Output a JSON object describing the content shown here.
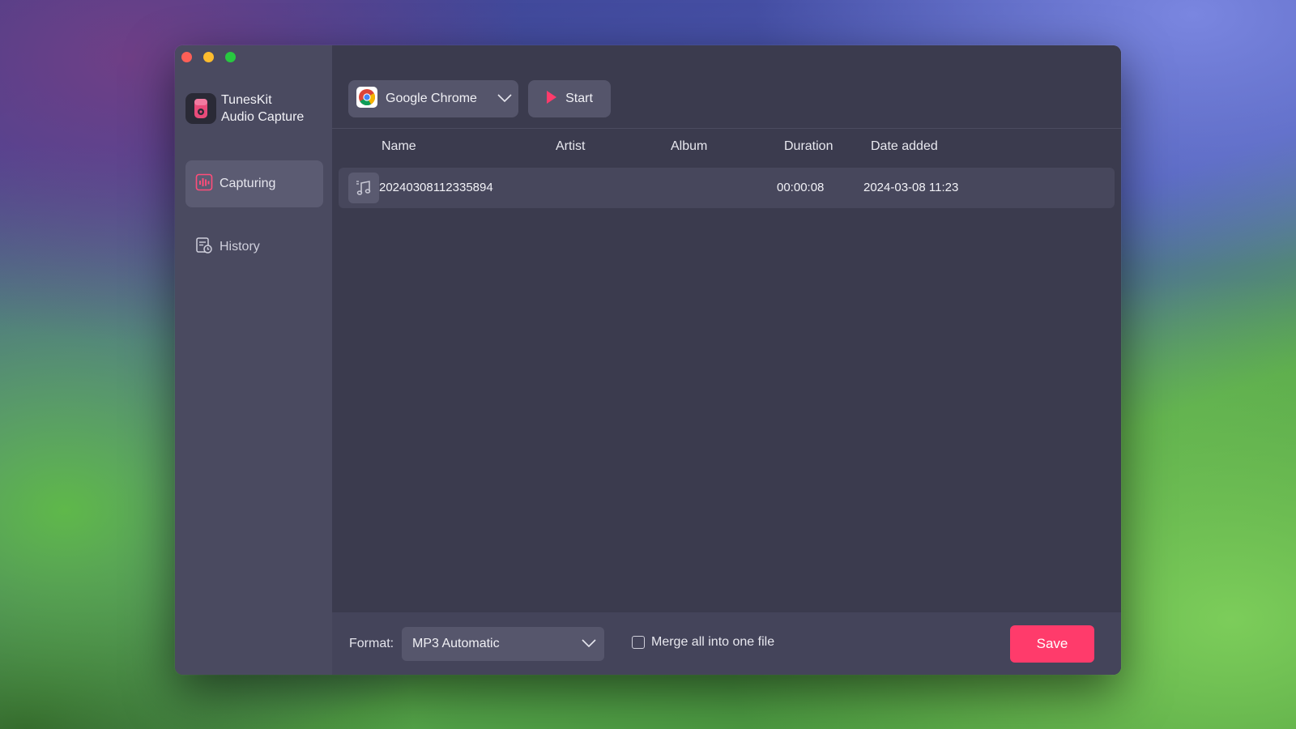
{
  "app": {
    "name_line1": "TunesKit",
    "name_line2": "Audio Capture"
  },
  "sidebar": {
    "items": [
      {
        "label": "Capturing",
        "icon": "capture-icon",
        "active": true
      },
      {
        "label": "History",
        "icon": "history-icon",
        "active": false
      }
    ]
  },
  "toolbar": {
    "source_app": "Google Chrome",
    "source_icon": "chrome-icon",
    "start_label": "Start"
  },
  "table": {
    "columns": [
      "Name",
      "Artist",
      "Album",
      "Duration",
      "Date added"
    ],
    "rows": [
      {
        "name": "20240308112335894",
        "artist": "",
        "album": "",
        "duration": "00:00:08",
        "date_added": "2024-03-08 11:23"
      }
    ]
  },
  "footer": {
    "format_label": "Format:",
    "format_value": "MP3 Automatic",
    "merge_label": "Merge all into one file",
    "merge_checked": false,
    "save_label": "Save"
  },
  "colors": {
    "accent": "#ff3b6b",
    "sidebar_bg": "#4a4a60",
    "main_bg": "#3b3b4e"
  }
}
